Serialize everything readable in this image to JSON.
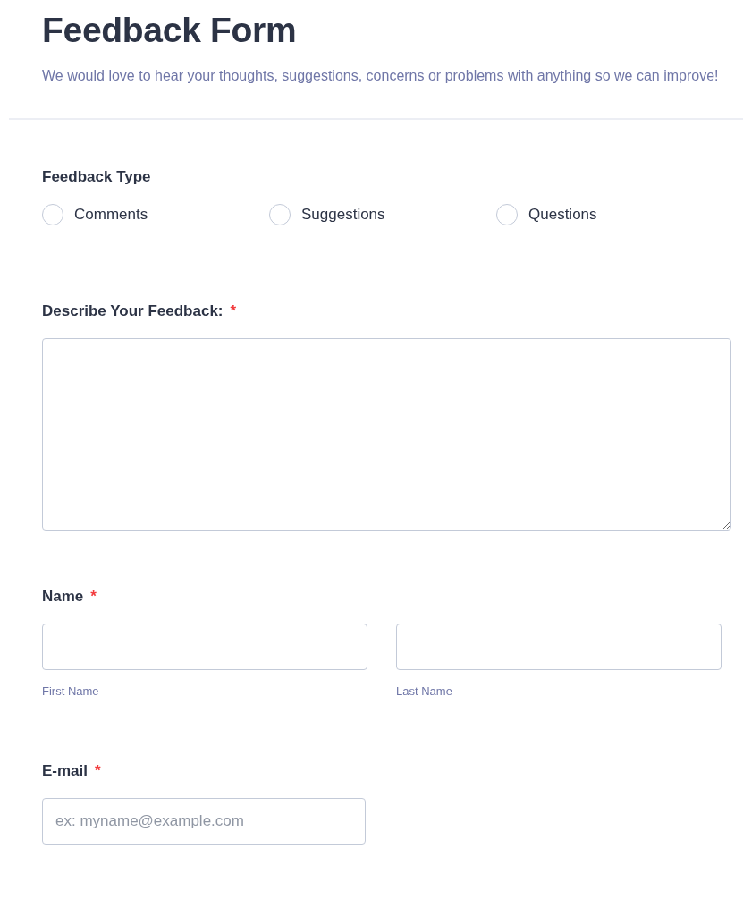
{
  "header": {
    "title": "Feedback Form",
    "description": "We would love to hear your thoughts, suggestions, concerns or problems with anything so we can improve!"
  },
  "feedback_type": {
    "label": "Feedback Type",
    "options": [
      {
        "label": "Comments",
        "selected": false
      },
      {
        "label": "Suggestions",
        "selected": false
      },
      {
        "label": "Questions",
        "selected": false
      }
    ]
  },
  "describe": {
    "label": "Describe Your Feedback:",
    "required_mark": "*"
  },
  "name": {
    "label": "Name",
    "required_mark": "*",
    "fields": [
      {
        "sublabel": "First Name"
      },
      {
        "sublabel": "Last Name"
      }
    ]
  },
  "email": {
    "label": "E-mail",
    "required_mark": "*",
    "placeholder": "ex: myname@example.com"
  }
}
